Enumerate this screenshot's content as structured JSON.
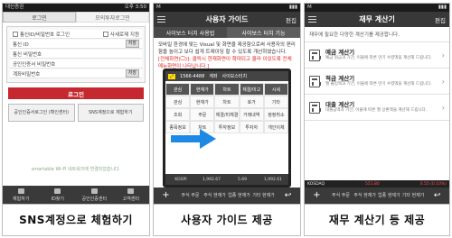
{
  "panels": [
    {
      "caption": "SNS계정으로 체험하기",
      "status_left": "대신증권",
      "status_right": "100%",
      "time": "오후 3:50",
      "tabs": [
        "로그인",
        "모의투자로그인"
      ],
      "rows": [
        {
          "label": "통신ID/비밀번호 로그인",
          "extra": "사세로제 지원"
        },
        {
          "label": "통신 ID",
          "extra": "저장"
        },
        {
          "label": "통신 비밀번호",
          "extra": ""
        },
        {
          "label": "공인인증서 비밀번호",
          "extra": ""
        },
        {
          "label": "계좌비밀번호",
          "extra": "저장"
        }
      ],
      "login_button": "로그인",
      "cert_button": "공인인증서로그인 (확인센터)",
      "sns_button": "SNS계정으로 체험하기",
      "wifi_text": "smartable Wi-Fi 네트워크에 연결되었습니다.",
      "bottom_nav": [
        "체험하기",
        "ID찾기",
        "공인인증센터",
        "고객센터"
      ]
    },
    {
      "caption": "사용자 가이드 제공",
      "title": "사용자 가이드",
      "edit": "편집",
      "tabs": [
        "사이보스 터치 사용법",
        "사이보스 터치 기능"
      ],
      "guide_text_1": "모바일 환경에 맞는 Visual 및 화면을 제공함으로써 사용자의 편리함을 높이고 보다 쉽게 트레이딩 할 수 있도록 개선하였습니다.",
      "guide_text_2": "[전체화면(🖵)]: 클릭시 현재화면이 확대되고 올라 이있도록 전체 메뉴화면이 나타납니다.]",
      "phone_top": [
        "1566-4488",
        "계좌",
        "사이보스터치"
      ],
      "grid": [
        "관심",
        "현재가",
        "차트",
        "체결/미고",
        "관심",
        "주문",
        "잔고/손익",
        "예수금",
        "관심차트",
        "시세",
        "관심",
        "현재가",
        "차트",
        "호가",
        "기타",
        "조회",
        "주문",
        "체결/미체결",
        "거래내역",
        "정정취소",
        "종목정보",
        "차트",
        "투자정보",
        "투자자",
        "개인이체"
      ],
      "phone_bottom": [
        "KOSPI",
        "1,992.67",
        "5.69",
        "1,992.61"
      ],
      "bottom_nav": [
        "주식 주문",
        "주식 현재가",
        "업종 현재가",
        "기타 현재가"
      ]
    },
    {
      "caption": "재무 계산기 등 제공",
      "title": "재무 계산기",
      "edit": "편집",
      "intro": "재무에 필요한 다양한 계산기를 제공합니다.",
      "items": [
        {
          "title": "예금 계산기",
          "desc": "예금 원금과 기간, 이율에 따른 만기 수령액을 계산해 드립니다."
        },
        {
          "title": "적금 계산기",
          "desc": "월 불입액과 기간, 이율에 따른 만기 수령액을 계산해 드립니다."
        },
        {
          "title": "대출 계산기",
          "desc": "대출금액과 기간, 이율에 따른 월 상환액을 계산해 드립니다."
        }
      ],
      "ticker": [
        "KOSDAQ",
        "551.80",
        "0.55 (0.10%)"
      ],
      "bottom_nav": [
        "주식 주문",
        "주식 현재가",
        "업종 현재가",
        "기타 현재가"
      ]
    }
  ]
}
